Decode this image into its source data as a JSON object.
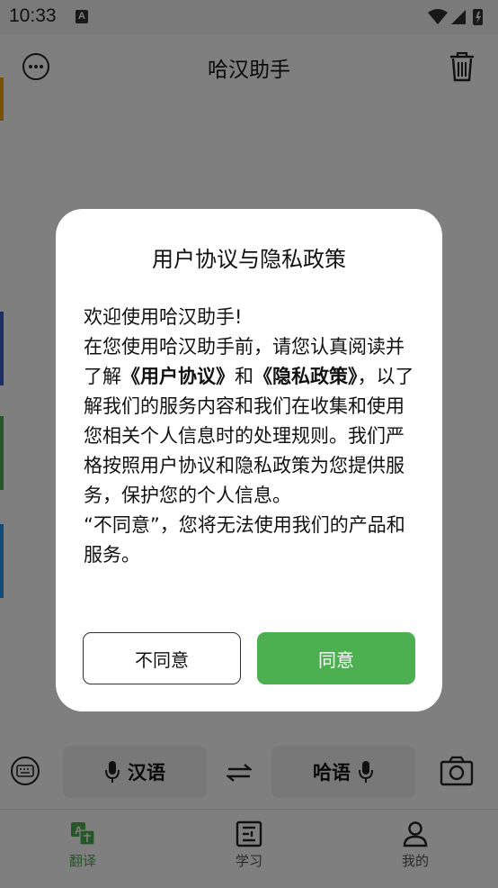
{
  "status_bar": {
    "time": "10:33",
    "notification_letter": "A"
  },
  "header": {
    "title": "哈汉助手",
    "menu_icon": "more-icon",
    "delete_icon": "trash-icon"
  },
  "input_row": {
    "left_lang": "汉语",
    "right_lang": "哈语",
    "keyboard_icon": "keyboard-icon",
    "swap_icon": "swap-icon",
    "camera_icon": "camera-icon"
  },
  "nav": {
    "items": [
      {
        "label": "翻译",
        "icon": "translate-icon",
        "active": true
      },
      {
        "label": "学习",
        "icon": "learn-icon",
        "active": false
      },
      {
        "label": "我的",
        "icon": "profile-icon",
        "active": false
      }
    ]
  },
  "dialog": {
    "title": "用户协议与隐私政策",
    "welcome": "欢迎使用哈汉助手!",
    "para_start": "在您使用哈汉助手前，请您认真阅读并了解",
    "user_agreement_link": "《用户协议》",
    "and": "和",
    "privacy_link": "《隐私政策》",
    "para_end": "，以了解我们的服务内容和我们在收集和使用您相关个人信息时的处理规则。我们严格按照用户协议和隐私政策为您提供服务，保护您的个人信息。",
    "decline_note": "“不同意”，您将无法使用我们的产品和服务。",
    "decline_button": "不同意",
    "agree_button": "同意"
  },
  "colors": {
    "accent": "#4caf50",
    "overlay": "rgba(0,0,0,0.5)"
  }
}
